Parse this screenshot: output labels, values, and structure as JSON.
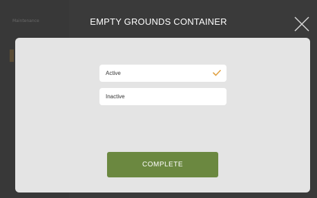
{
  "background": {
    "sidebar_title": "Maintenance"
  },
  "modal": {
    "title": "EMPTY GROUNDS CONTAINER",
    "options": [
      {
        "label": "Active",
        "selected": true
      },
      {
        "label": "Inactive",
        "selected": false
      }
    ],
    "complete_label": "COMPLETE"
  },
  "colors": {
    "accent_green": "#6b8840",
    "check_orange": "#e0a040",
    "panel": "#e4e4e4",
    "overlay": "#2f2f2f"
  },
  "icons": {
    "close": "close-icon",
    "check": "check-icon"
  }
}
